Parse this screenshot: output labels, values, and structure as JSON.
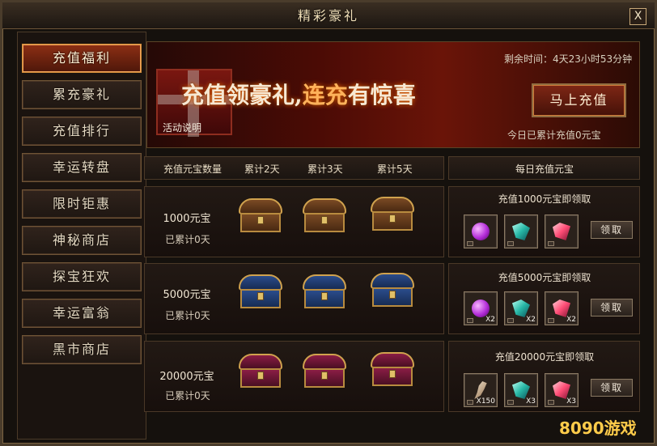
{
  "window": {
    "title": "精彩豪礼",
    "close_label": "X"
  },
  "sidebar": {
    "items": [
      {
        "label": "充值福利",
        "active": true
      },
      {
        "label": "累充豪礼",
        "active": false
      },
      {
        "label": "充值排行",
        "active": false
      },
      {
        "label": "幸运转盘",
        "active": false
      },
      {
        "label": "限时钜惠",
        "active": false
      },
      {
        "label": "神秘商店",
        "active": false
      },
      {
        "label": "探宝狂欢",
        "active": false
      },
      {
        "label": "幸运富翁",
        "active": false
      },
      {
        "label": "黑市商店",
        "active": false
      }
    ]
  },
  "banner": {
    "headline_part1": "充值领豪礼,",
    "headline_part2": "连充",
    "headline_part3": "有惊喜",
    "time_left": "剩余时间：4天23小时53分钟",
    "rules_link": "活动说明",
    "today_total": "今日已累计充值0元宝",
    "charge_button": "马上充值"
  },
  "left_table": {
    "headers": [
      "充值元宝数量",
      "累计2天",
      "累计3天",
      "累计5天"
    ],
    "rows": [
      {
        "amount": "1000元宝",
        "accumulated": "已累计0天"
      },
      {
        "amount": "5000元宝",
        "accumulated": "已累计0天"
      },
      {
        "amount": "20000元宝",
        "accumulated": "已累计0天"
      }
    ]
  },
  "right_panel": {
    "header": "每日充值元宝",
    "sections": [
      {
        "title": "充值1000元宝即领取",
        "items": [
          {
            "icon": "purple-orb-icon",
            "qty": ""
          },
          {
            "icon": "teal-crystal-icon",
            "qty": ""
          },
          {
            "icon": "pink-crystal-icon",
            "qty": ""
          }
        ],
        "button": "领取"
      },
      {
        "title": "充值5000元宝即领取",
        "items": [
          {
            "icon": "purple-orb-icon",
            "qty": "X2"
          },
          {
            "icon": "teal-crystal-icon",
            "qty": "X2"
          },
          {
            "icon": "pink-crystal-icon",
            "qty": "X2"
          }
        ],
        "button": "领取"
      },
      {
        "title": "充值20000元宝即领取",
        "items": [
          {
            "icon": "feather-icon",
            "qty": "X150"
          },
          {
            "icon": "teal-crystal-icon",
            "qty": "X3"
          },
          {
            "icon": "pink-crystal-icon",
            "qty": "X3"
          }
        ],
        "button": "领取"
      }
    ]
  },
  "watermark": {
    "brand_number": "8090",
    "brand_text": "游戏"
  }
}
